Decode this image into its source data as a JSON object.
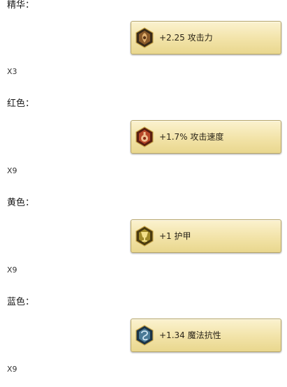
{
  "sections": [
    {
      "label": "精华：",
      "stat": "+2.25 攻击力",
      "count": "X3",
      "icon": "quintessence-rune-icon",
      "icon_colors": {
        "outer": "#3a2a18",
        "inner": "#8a5a2a",
        "glyph": "#e0b070"
      }
    },
    {
      "label": "红色：",
      "stat": "+1.7% 攻击速度",
      "count": "X9",
      "icon": "mark-rune-icon",
      "icon_colors": {
        "outer": "#5a1e10",
        "inner": "#b8482a",
        "glyph": "#f0c090"
      }
    },
    {
      "label": "黄色：",
      "stat": "+1 护甲",
      "count": "X9",
      "icon": "seal-rune-icon",
      "icon_colors": {
        "outer": "#4a3a10",
        "inner": "#a08a2a",
        "glyph": "#f3e08a"
      }
    },
    {
      "label": "蓝色：",
      "stat": "+1.34 魔法抗性",
      "count": "X9",
      "icon": "glyph-rune-icon",
      "icon_colors": {
        "outer": "#1c3446",
        "inner": "#4a7a96",
        "glyph": "#cfe6f2"
      }
    }
  ]
}
